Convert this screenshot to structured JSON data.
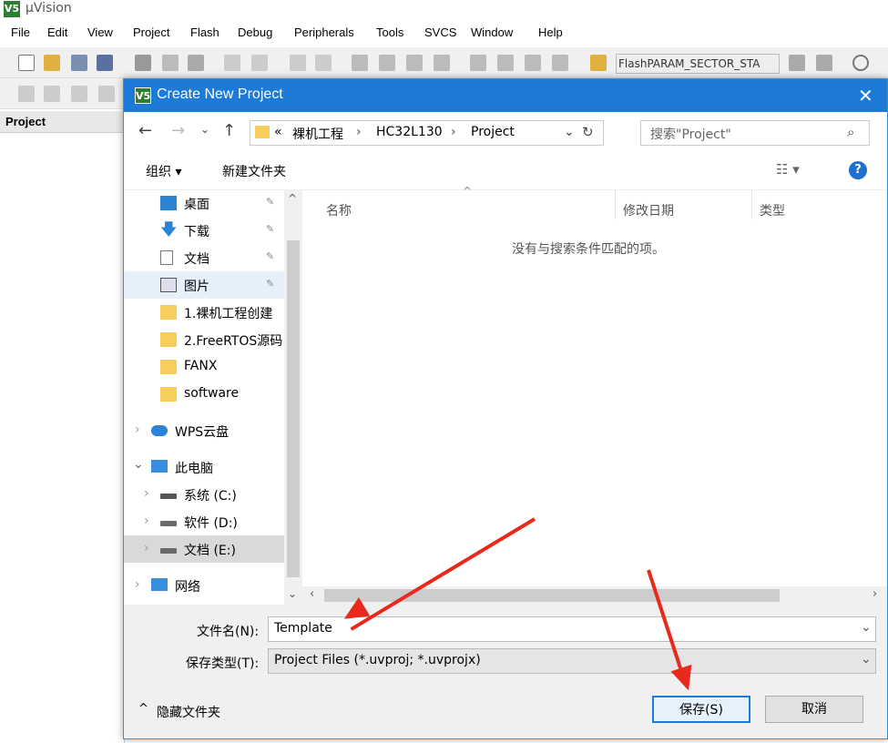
{
  "app": {
    "title": "µVision",
    "icon_text": "V5"
  },
  "menu": [
    "File",
    "Edit",
    "View",
    "Project",
    "Flash",
    "Debug",
    "Peripherals",
    "Tools",
    "SVCS",
    "Window",
    "Help"
  ],
  "toolbar": {
    "target_combo": "FlashPARAM_SECTOR_STA"
  },
  "project_pane": {
    "header": "Project"
  },
  "dialog": {
    "title": "Create New Project",
    "address": {
      "prefix": "«",
      "crumbs": [
        "裸机工程",
        "HC32L130",
        "Project"
      ]
    },
    "search_placeholder": "搜索\"Project\"",
    "organize_label": "组织 ▾",
    "new_folder_label": "新建文件夹",
    "nav_items": [
      {
        "label": "桌面",
        "icon": "desktop-icon",
        "pinned": true
      },
      {
        "label": "下载",
        "icon": "download-icon",
        "pinned": true
      },
      {
        "label": "文档",
        "icon": "document-icon",
        "pinned": true
      },
      {
        "label": "图片",
        "icon": "picture-icon",
        "pinned": true
      },
      {
        "label": "1.裸机工程创建",
        "icon": "folder-icon"
      },
      {
        "label": "2.FreeRTOS源码",
        "icon": "folder-icon"
      },
      {
        "label": "FANX",
        "icon": "folder-icon"
      },
      {
        "label": "software",
        "icon": "folder-icon"
      },
      {
        "label": "WPS云盘",
        "icon": "cloud-icon"
      },
      {
        "label": "此电脑",
        "icon": "computer-icon"
      },
      {
        "label": "系统 (C:)",
        "icon": "drive-icon"
      },
      {
        "label": "软件 (D:)",
        "icon": "drive-icon"
      },
      {
        "label": "文档 (E:)",
        "icon": "drive-icon"
      },
      {
        "label": "网络",
        "icon": "network-icon"
      }
    ],
    "columns": [
      "名称",
      "修改日期",
      "类型"
    ],
    "empty_message": "没有与搜索条件匹配的项。",
    "filename_label": "文件名(N):",
    "filename_value": "Template",
    "filetype_label": "保存类型(T):",
    "filetype_value": "Project Files (*.uvproj; *.uvprojx)",
    "hide_folders_label": "隐藏文件夹",
    "save_label": "保存(S)",
    "cancel_label": "取消"
  },
  "colors": {
    "title_bar": "#1e7ad7",
    "annotation_arrow": "#e8291b",
    "folder": "#f7cd5b"
  }
}
